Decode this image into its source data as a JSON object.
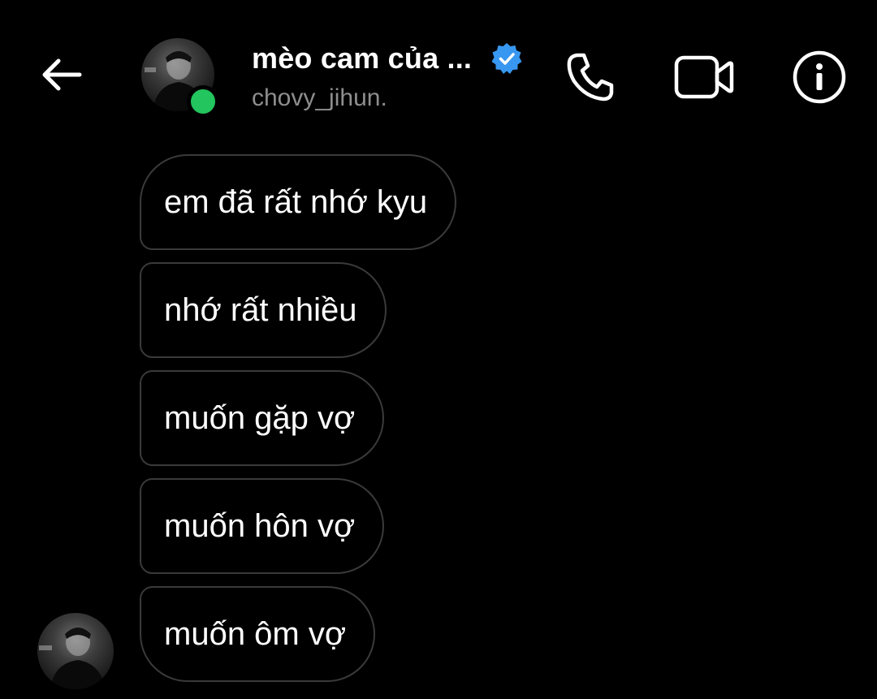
{
  "header": {
    "display_name": "mèo cam của ...",
    "username": "chovy_jihun.",
    "verified": true,
    "online": true,
    "online_color": "#22c55e",
    "verified_color": "#3897f0",
    "icons": {
      "back": "back-arrow-icon",
      "call": "phone-icon",
      "video": "video-camera-icon",
      "info": "info-icon"
    }
  },
  "messages": [
    {
      "text": "em đã rất nhớ kyu"
    },
    {
      "text": "nhớ rất nhiều"
    },
    {
      "text": "muốn gặp vợ"
    },
    {
      "text": "muốn hôn vợ"
    },
    {
      "text": "muốn ôm vợ"
    }
  ]
}
